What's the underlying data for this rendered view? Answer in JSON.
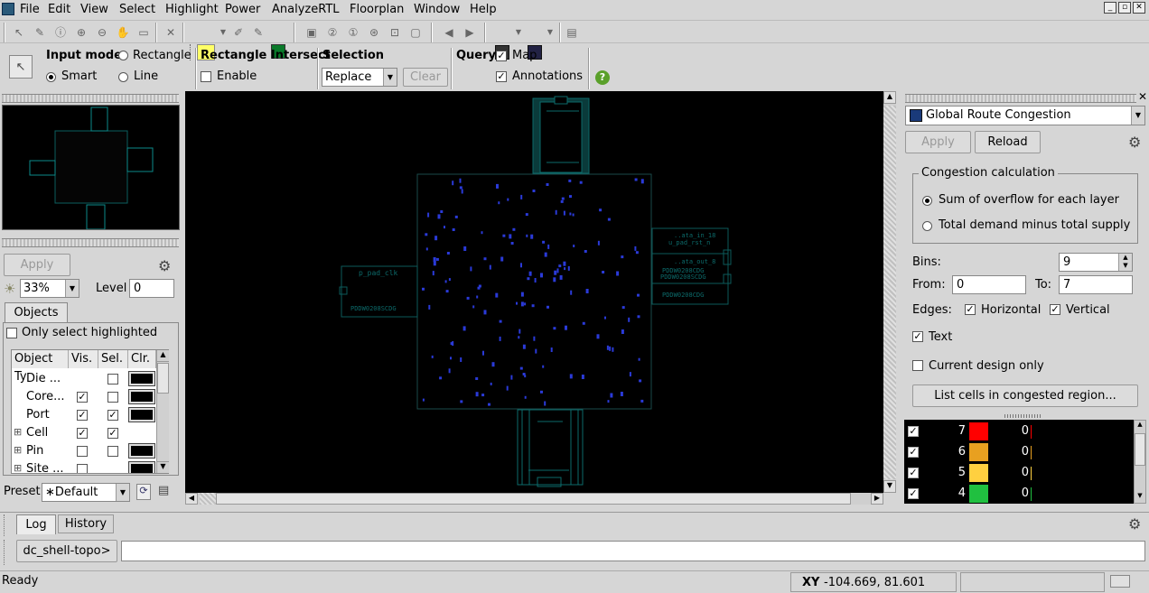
{
  "menu": [
    "File",
    "Edit",
    "View",
    "Select",
    "Highlight",
    "Power",
    "AnalyzeRTL",
    "Floorplan",
    "Window",
    "Help"
  ],
  "toolbar2": {
    "input_mode_label": "Input mode",
    "rectangle_label": "Rectangle",
    "smart_label": "Smart",
    "line_label": "Line",
    "rect_intersect_label": "Rectangle Intersect",
    "enable_label": "Enable",
    "selection_label": "Selection",
    "selection_value": "Replace",
    "clear_label": "Clear",
    "query_label": "Query",
    "map_label": "Map",
    "annotations_label": "Annotations",
    "help_glyph": "?"
  },
  "left_panel": {
    "apply_label": "Apply",
    "brightness_value": "33%",
    "level_label": "Level",
    "level_value": "0",
    "objects_tab": "Objects",
    "only_select_highlighted": "Only select highlighted",
    "table_headers": [
      "Object Ty",
      "Vis.",
      "Sel.",
      "Clr."
    ],
    "rows": [
      {
        "name": "Die ...",
        "vis": false,
        "sel": false,
        "expand": false
      },
      {
        "name": "Core...",
        "vis": true,
        "sel": false,
        "expand": false
      },
      {
        "name": "Port",
        "vis": true,
        "sel": true,
        "expand": false
      },
      {
        "name": "Cell",
        "vis": true,
        "sel": true,
        "expand": true
      },
      {
        "name": "Pin",
        "vis": false,
        "sel": false,
        "expand": true
      },
      {
        "name": "Site ...",
        "vis": false,
        "sel": false,
        "expand": true
      }
    ],
    "preset_label": "Preset",
    "preset_value": "∗Default"
  },
  "canvas_labels": {
    "pad_left_a": "p_pad_clk",
    "pad_left_b": "PDDW0208SCDG",
    "pad_right_a": "..ata_in_18",
    "pad_right_b": "u_pad_rst_n",
    "pad_right_c": "..ata_out_8",
    "pad_right_d": "PDDW0208CDG",
    "pad_right_e": "PDDW0208SCDG",
    "pad_right_f": "PDDW0208CDG"
  },
  "right_panel": {
    "map_select": "Global Route Congestion",
    "apply_label": "Apply",
    "reload_label": "Reload",
    "group_title": "Congestion calculation",
    "option1": "Sum of overflow for each layer",
    "option2": "Total demand minus total supply",
    "bins_label": "Bins:",
    "bins_value": "9",
    "from_label": "From:",
    "from_value": "0",
    "to_label": "To:",
    "to_value": "7",
    "edges_label": "Edges:",
    "horizontal_label": "Horizontal",
    "vertical_label": "Vertical",
    "text_label": "Text",
    "current_design_label": "Current design only",
    "list_cells_label": "List cells in congested region...",
    "legend": [
      {
        "level": "7",
        "color": "#ff0000",
        "count": "0"
      },
      {
        "level": "6",
        "color": "#e8a020",
        "count": "0"
      },
      {
        "level": "5",
        "color": "#ffd040",
        "count": "0"
      },
      {
        "level": "4",
        "color": "#20c040",
        "count": "0"
      }
    ]
  },
  "console": {
    "tabs": [
      "Log",
      "History"
    ],
    "prompt": "dc_shell-topo>"
  },
  "status": {
    "ready": "Ready",
    "xy_label": "XY",
    "xy_value": "-104.669, 81.601"
  }
}
